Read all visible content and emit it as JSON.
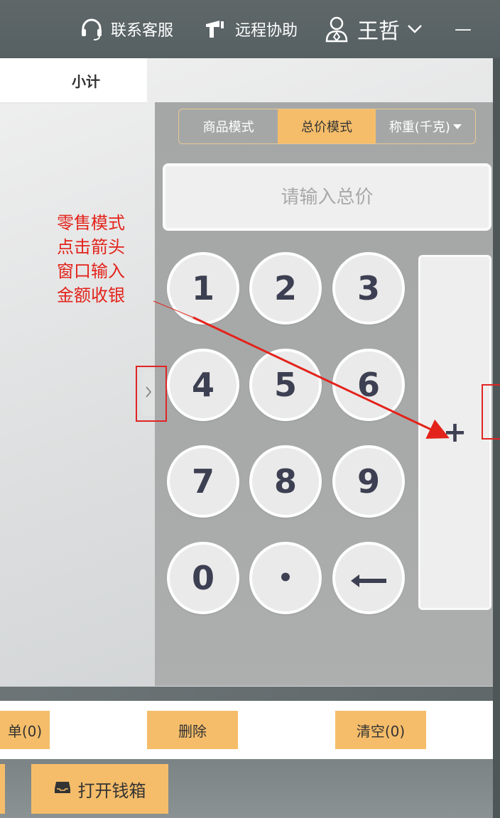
{
  "topbar": {
    "customer_service": "联系客服",
    "remote_assist": "远程协助",
    "user_name": "王哲",
    "minimize": "—"
  },
  "order": {
    "subtotal_header": "小计"
  },
  "modes": {
    "product": "商品模式",
    "total_price": "总价模式",
    "weigh": "称重(千克)",
    "active": "总价模式"
  },
  "price_input": {
    "placeholder": "请输入总价",
    "value": ""
  },
  "keypad": {
    "keys": [
      "1",
      "2",
      "3",
      "4",
      "5",
      "6",
      "7",
      "8",
      "9",
      "0",
      "•",
      "⟵"
    ],
    "plus": "+"
  },
  "annotation": {
    "lines": [
      "零售模式",
      "点击箭头",
      "窗口输入",
      "金额收银"
    ],
    "color": "#e3231b"
  },
  "actions": {
    "hold_partial": "单(0)",
    "delete": "删除",
    "clear": "清空(0)",
    "open_cash_drawer": "打开钱箱"
  },
  "colors": {
    "accent": "#f5bd6a",
    "topbar": "#5f6769",
    "key_text": "#3d3f52",
    "annotation_red": "#e3231b"
  }
}
